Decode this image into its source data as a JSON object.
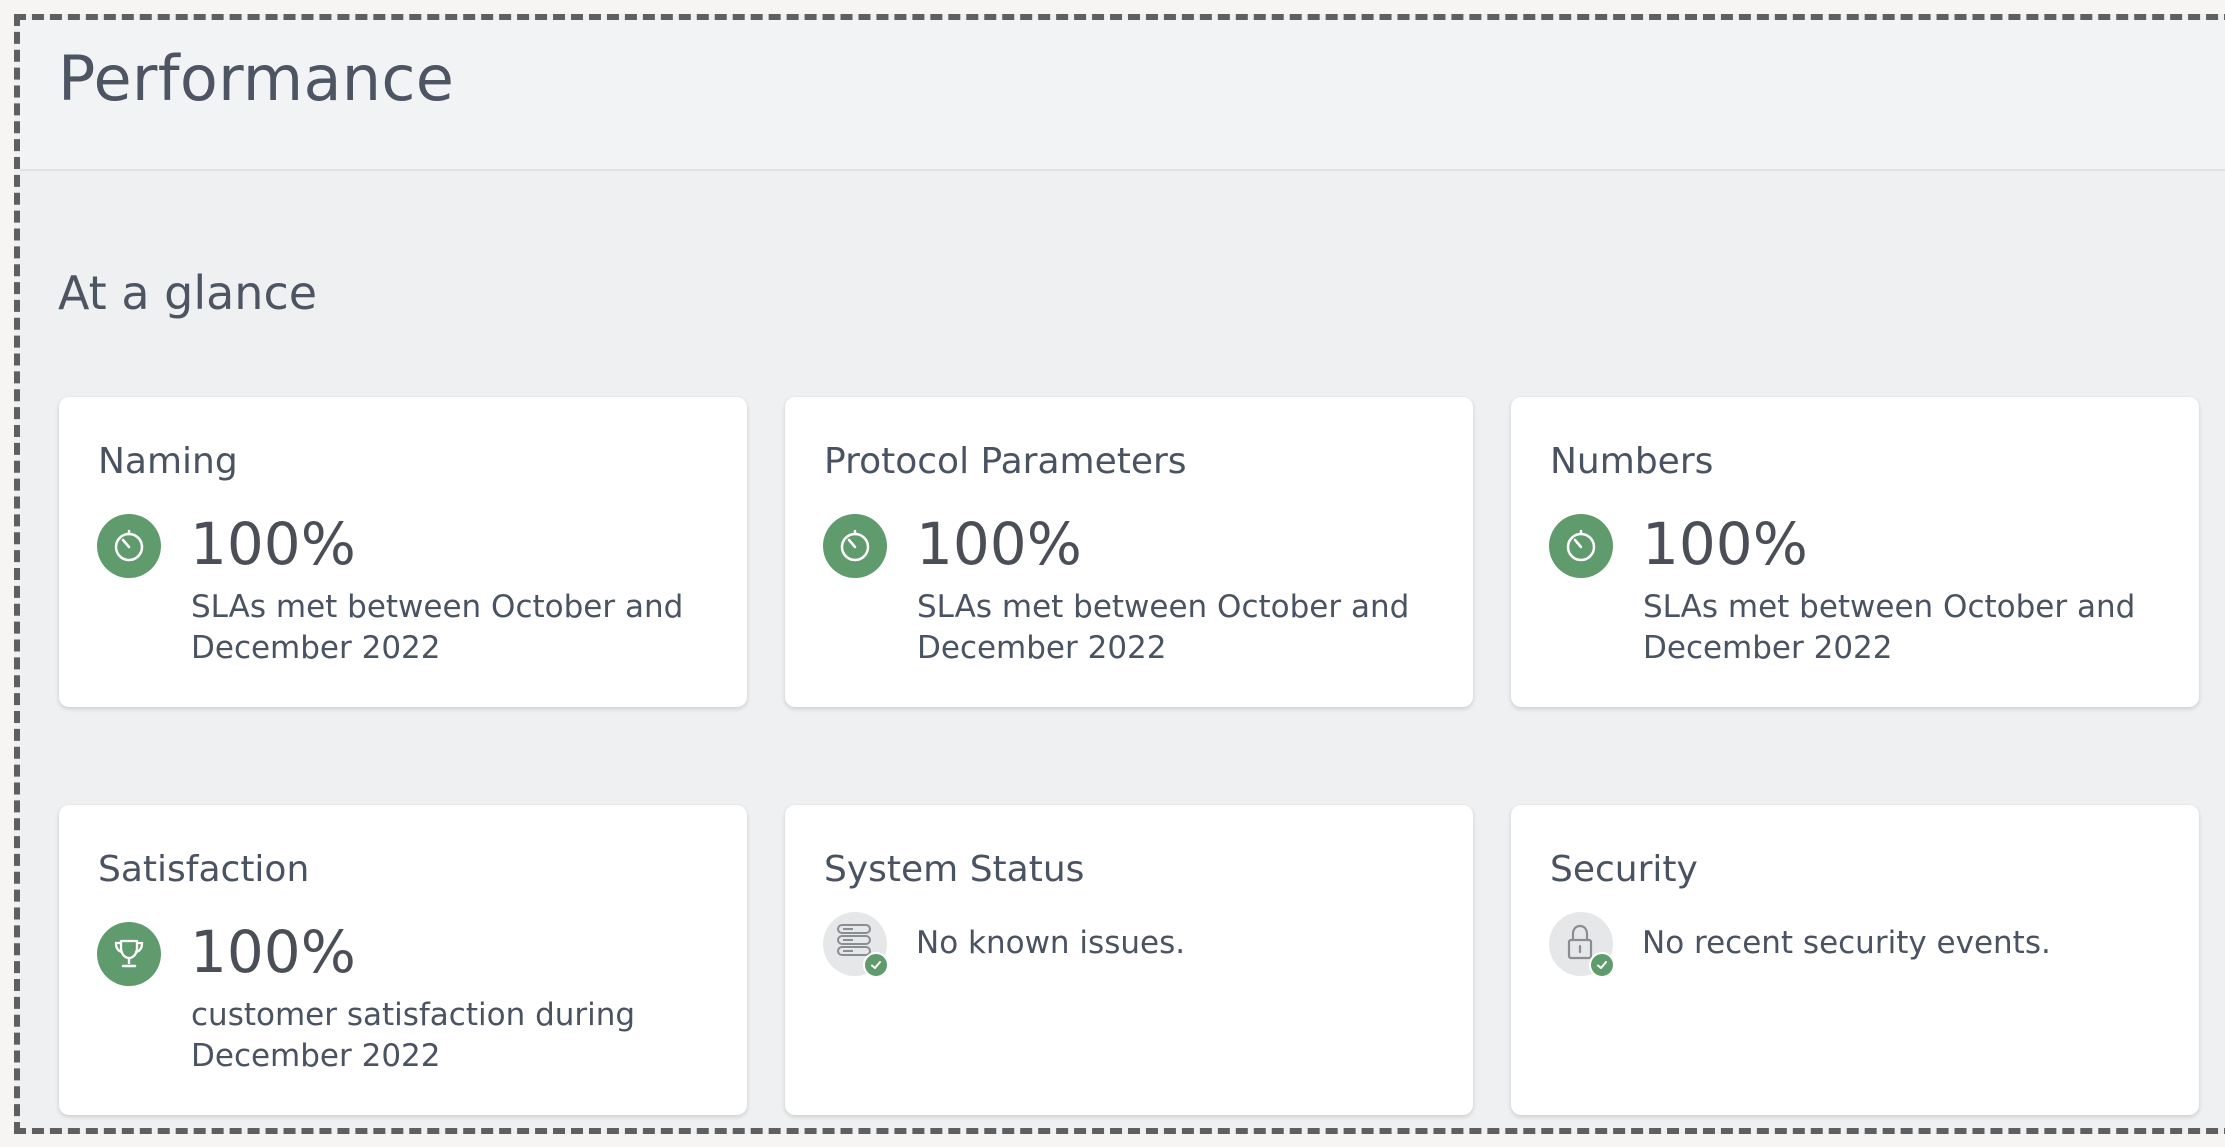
{
  "header": {
    "title": "Performance"
  },
  "section": {
    "title": "At a glance"
  },
  "cards": [
    {
      "title": "Naming",
      "icon": "stopwatch-icon",
      "value": "100%",
      "description": "SLAs met between October and December 2022"
    },
    {
      "title": "Protocol Parameters",
      "icon": "stopwatch-icon",
      "value": "100%",
      "description": "SLAs met between October and December 2022"
    },
    {
      "title": "Numbers",
      "icon": "stopwatch-icon",
      "value": "100%",
      "description": "SLAs met between October and December 2022"
    },
    {
      "title": "Satisfaction",
      "icon": "trophy-icon",
      "value": "100%",
      "description": "customer satisfaction during December 2022"
    },
    {
      "title": "System Status",
      "icon": "server-check-icon",
      "status": "No known issues."
    },
    {
      "title": "Security",
      "icon": "lock-check-icon",
      "status": "No recent security events."
    }
  ],
  "colors": {
    "accent_green": "#5f9b6d",
    "card_bg": "#ffffff",
    "page_bg": "#eef0f2",
    "text": "#4a5361"
  }
}
